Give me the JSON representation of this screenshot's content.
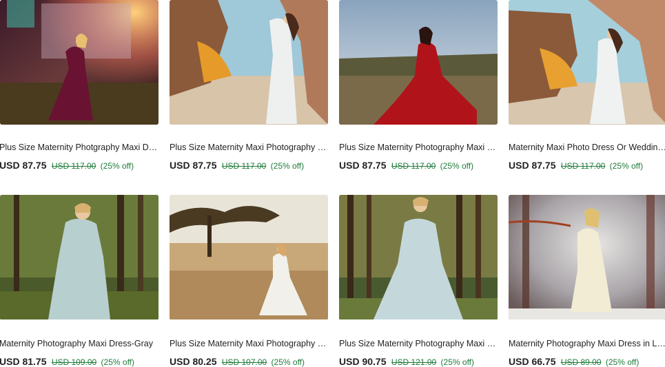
{
  "listings": [
    {
      "title": "Plus Size Maternity Photgraphy Maxi Dress",
      "price": "USD 87.75",
      "original_price": "USD 117.00",
      "discount": "(25% off)",
      "image": "woman-in-burgundy-gown-at-sunset"
    },
    {
      "title": "Plus Size Maternity Maxi Photography Dress",
      "price": "USD 87.75",
      "original_price": "USD 117.00",
      "discount": "(25% off)",
      "image": "woman-in-white-gown-at-sea-rocks"
    },
    {
      "title": "Plus Size Maternity Photography Maxi Dress",
      "price": "USD 87.75",
      "original_price": "USD 117.00",
      "discount": "(25% off)",
      "image": "woman-in-red-gown-in-field"
    },
    {
      "title": "Maternity Maxi Photo Dress Or Wedding Dress",
      "price": "USD 87.75",
      "original_price": "USD 117.00",
      "discount": "(25% off)",
      "image": "woman-in-white-gown-at-sea-rocks"
    },
    {
      "title": "Maternity Photography Maxi Dress-Gray",
      "price": "USD 81.75",
      "original_price": "USD 109.00",
      "discount": "(25% off)",
      "image": "woman-in-pale-blue-gown-in-forest"
    },
    {
      "title": "Plus Size Maternity Maxi Photography Dress",
      "price": "USD 80.25",
      "original_price": "USD 107.00",
      "discount": "(25% off)",
      "image": "woman-in-white-gown-in-golden-meadow"
    },
    {
      "title": "Plus Size Maternity Photography Maxi Dress",
      "price": "USD 90.75",
      "original_price": "USD 121.00",
      "discount": "(25% off)",
      "image": "woman-in-pale-blue-gown-in-forest"
    },
    {
      "title": "Maternity Photography Maxi Dress in Lace",
      "price": "USD 66.75",
      "original_price": "USD 89.00",
      "discount": "(25% off)",
      "image": "woman-in-cream-gown-in-winter-woods"
    }
  ],
  "colors": {
    "discount_green": "#1e7a3a",
    "text": "#222222"
  }
}
